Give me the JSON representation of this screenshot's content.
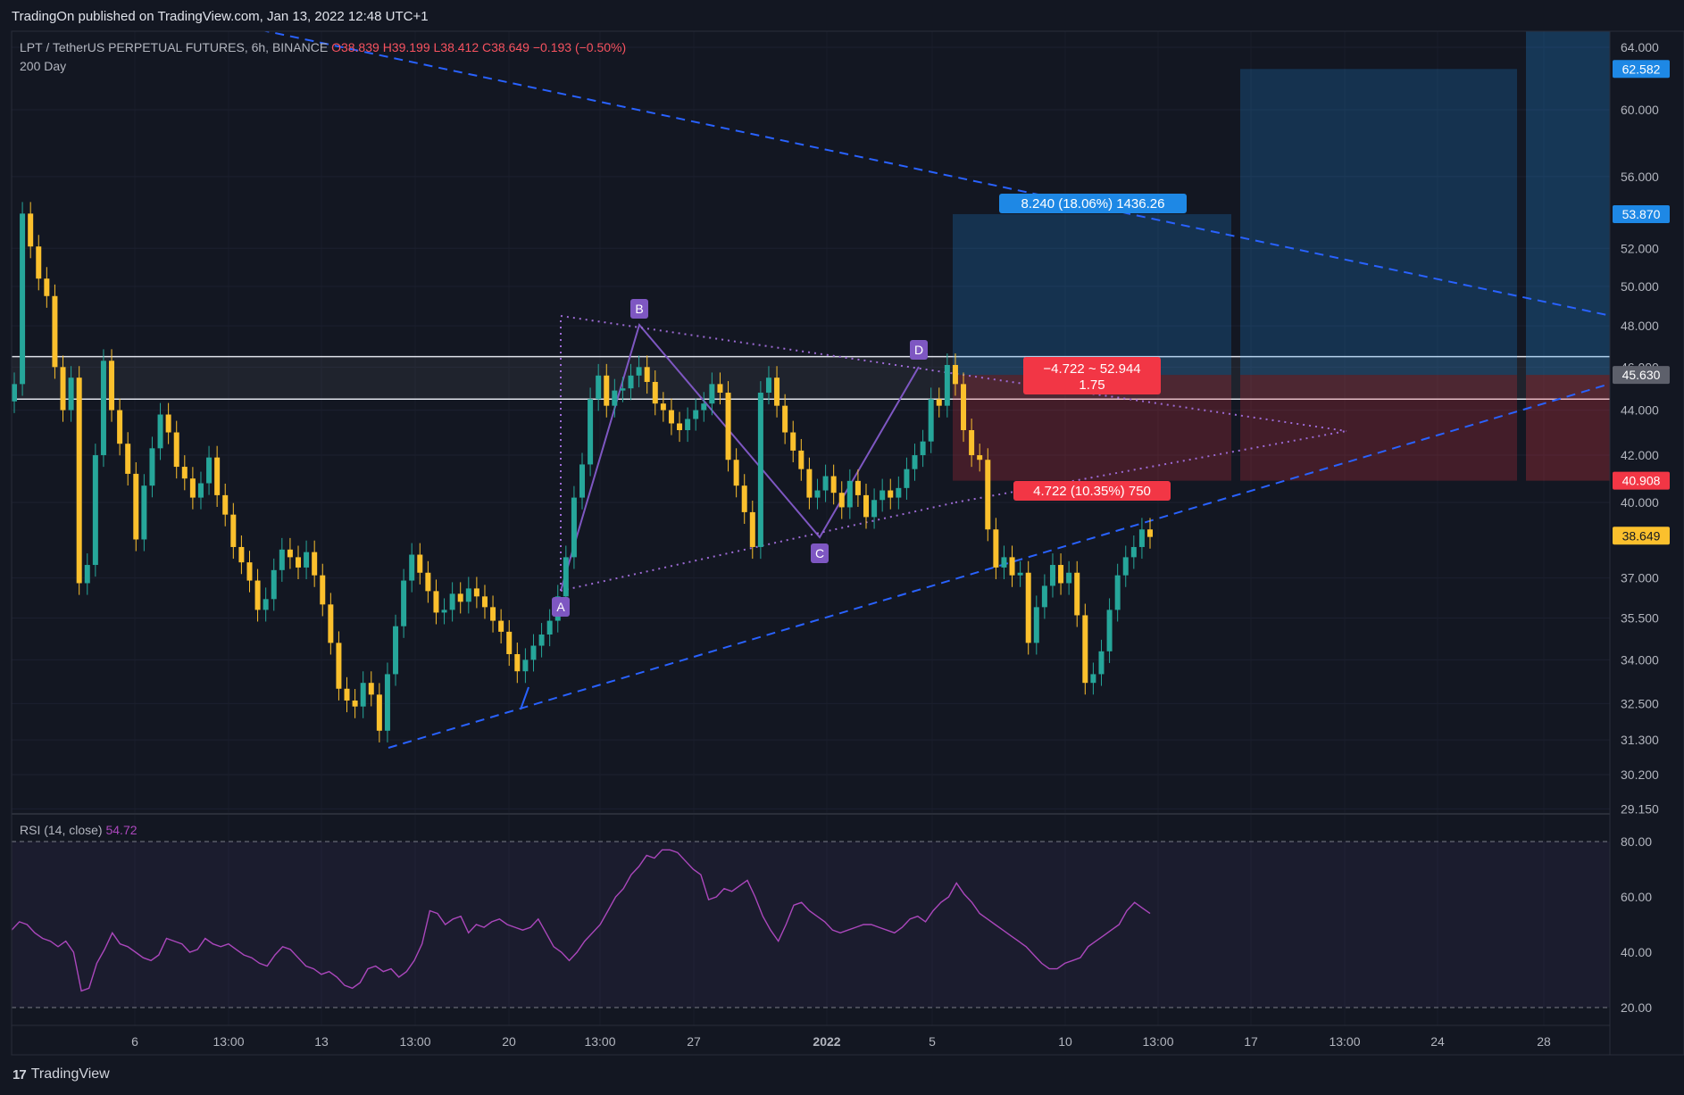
{
  "publisher": "TradingOn published on TradingView.com, Jan 13, 2022 12:48 UTC+1",
  "symbol": "LPT / TetherUS PERPETUAL FUTURES, 6h, BINANCE",
  "ohlc": {
    "o": "O38.839",
    "h": "H39.199",
    "l": "L38.412",
    "c": "C38.649",
    "chg": "−0.193 (−0.50%)"
  },
  "indicator_ma": "200 Day",
  "rsi": {
    "label": "RSI (14, close)",
    "value": "54.72"
  },
  "footer": {
    "logo": "17",
    "name": "TradingView"
  },
  "colors": {
    "bg": "#131722",
    "up": "#26a69a",
    "down": "#fbc02d",
    "rsi": "#ab47bc",
    "pattern": "#7e57c2",
    "trend": "#2962ff",
    "target": "#1e88e5",
    "stop": "#f23645"
  },
  "chart_data": {
    "type": "candlestick",
    "interval": "6h",
    "price_ticks": [
      "64.000",
      "60.000",
      "56.000",
      "52.000",
      "50.000",
      "48.000",
      "46.000",
      "44.000",
      "42.000",
      "40.000",
      "37.000",
      "35.500",
      "34.000",
      "32.500",
      "31.300",
      "30.200",
      "29.150"
    ],
    "price_labels": [
      {
        "value": "62.582",
        "color": "#1e88e5"
      },
      {
        "value": "53.870",
        "color": "#1e88e5"
      },
      {
        "value": "45.630",
        "color": "#5d606b"
      },
      {
        "value": "40.908",
        "color": "#f23645"
      },
      {
        "value": "38.649",
        "color": "#fbc02d"
      }
    ],
    "rsi_ticks": [
      "80.00",
      "60.00",
      "40.00",
      "20.00"
    ],
    "time_ticks": [
      "6",
      "13:00",
      "13",
      "13:00",
      "20",
      "13:00",
      "27",
      "2022",
      "5",
      "10",
      "13:00",
      "17",
      "13:00",
      "24",
      "28"
    ],
    "horizontal_levels": [
      46.5,
      44.5
    ],
    "harmonic_points": [
      "A",
      "B",
      "C",
      "D"
    ],
    "position": {
      "target_label": "8.240 (18.06%) 1436.26",
      "entry_label": "−4.722 ~ 52.944",
      "ratio_label": "1.75",
      "stop_label": "4.722 (10.35%) 750",
      "target": 53.87,
      "entry": 45.63,
      "stop": 40.908
    },
    "closes": [
      45.2,
      53.9,
      52.1,
      50.4,
      49.5,
      46.0,
      44.0,
      45.5,
      36.8,
      37.5,
      42.0,
      46.3,
      44.0,
      42.5,
      41.2,
      38.5,
      40.7,
      42.3,
      43.8,
      43.0,
      41.5,
      41.0,
      40.2,
      40.8,
      41.9,
      40.3,
      39.5,
      38.2,
      37.6,
      36.9,
      35.8,
      36.2,
      37.3,
      38.1,
      37.8,
      37.4,
      38.0,
      37.1,
      36.0,
      34.6,
      33.0,
      32.6,
      32.4,
      33.2,
      32.8,
      31.6,
      33.5,
      35.2,
      36.9,
      37.9,
      37.2,
      36.5,
      35.7,
      35.8,
      36.4,
      36.1,
      36.6,
      36.3,
      35.9,
      35.4,
      35.0,
      34.2,
      33.6,
      34.0,
      34.5,
      34.9,
      35.4,
      36.3,
      37.8,
      40.2,
      41.6,
      44.5,
      45.6,
      44.2,
      44.9,
      45.0,
      45.6,
      46.0,
      45.3,
      44.3,
      44.0,
      43.4,
      43.1,
      43.6,
      44.0,
      44.3,
      45.2,
      44.8,
      41.8,
      40.7,
      39.6,
      38.2,
      44.8,
      45.5,
      44.2,
      43.0,
      42.2,
      41.4,
      40.2,
      40.5,
      41.1,
      40.4,
      39.8,
      40.9,
      40.3,
      39.4,
      40.1,
      40.5,
      40.2,
      40.6,
      41.4,
      42.0,
      42.6,
      44.5,
      44.2,
      46.1,
      45.2,
      43.1,
      42.0,
      41.8,
      38.9,
      37.4,
      37.8,
      37.1,
      37.2,
      34.6,
      35.9,
      36.7,
      37.5,
      36.8,
      37.2,
      35.6,
      33.2,
      33.5,
      34.3,
      35.8,
      37.1,
      37.8,
      38.2,
      38.9,
      38.6
    ],
    "rsi_values": [
      48,
      51,
      50,
      47,
      45,
      44,
      42,
      44,
      40,
      26,
      27,
      36,
      41,
      47,
      43,
      42,
      40,
      38,
      37,
      39,
      45,
      44,
      43,
      40,
      41,
      45,
      43,
      42,
      43,
      41,
      39,
      38,
      36,
      35,
      39,
      42,
      41,
      38,
      35,
      34,
      32,
      33,
      31,
      28,
      27,
      29,
      34,
      35,
      33,
      34,
      31,
      33,
      37,
      43,
      55,
      54,
      50,
      52,
      53,
      47,
      50,
      49,
      51,
      52,
      50,
      49,
      48,
      49,
      52,
      47,
      42,
      40,
      37,
      40,
      44,
      47,
      50,
      55,
      60,
      63,
      68,
      71,
      75,
      74,
      77,
      77,
      76,
      73,
      70,
      68,
      59,
      60,
      63,
      62,
      64,
      66,
      60,
      53,
      48,
      44,
      50,
      57,
      58,
      55,
      53,
      51,
      48,
      47,
      48,
      49,
      50,
      50,
      49,
      48,
      47,
      49,
      52,
      53,
      51,
      55,
      58,
      60,
      65,
      61,
      58,
      54,
      52,
      50,
      48,
      46,
      44,
      42,
      39,
      36,
      34,
      34,
      36,
      37,
      38,
      42,
      44,
      46,
      48,
      50,
      55,
      58,
      56,
      54
    ]
  }
}
